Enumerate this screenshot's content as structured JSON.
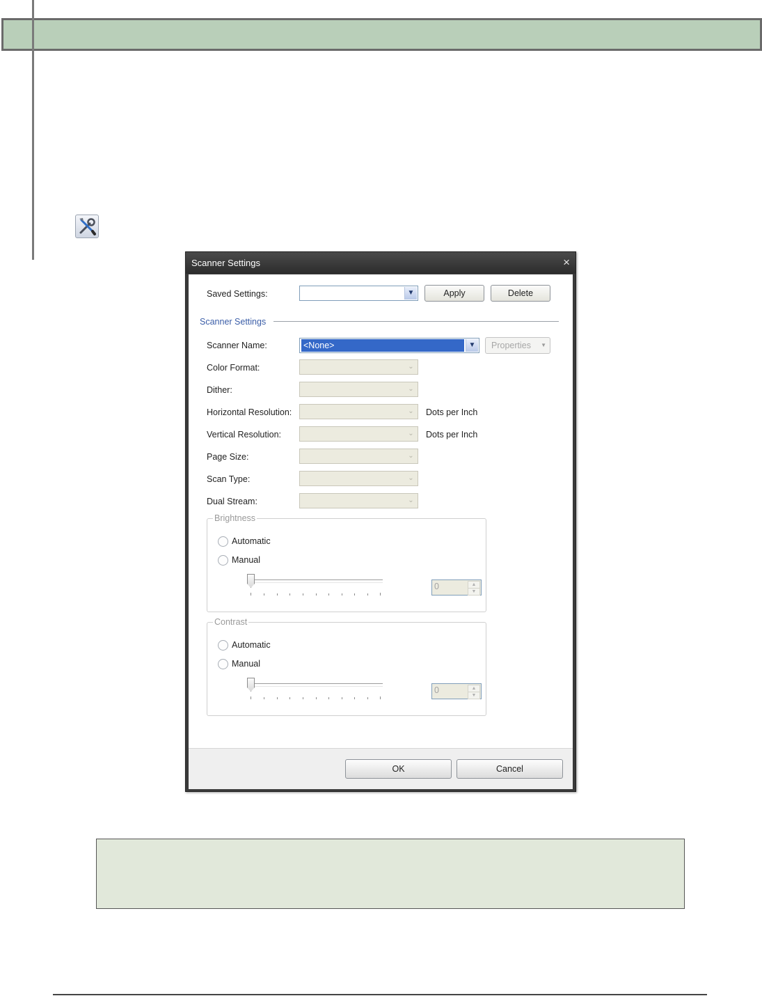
{
  "dialog": {
    "title": "Scanner Settings",
    "close_glyph": "×",
    "saved_settings": {
      "label": "Saved Settings:",
      "value": "",
      "apply_label": "Apply",
      "delete_label": "Delete"
    },
    "group_label": "Scanner Settings",
    "scanner_name": {
      "label": "Scanner Name:",
      "value": "<None>",
      "properties_label": "Properties"
    },
    "fields": [
      {
        "label": "Color Format:",
        "value": "",
        "unit": ""
      },
      {
        "label": "Dither:",
        "value": "",
        "unit": ""
      },
      {
        "label": "Horizontal Resolution:",
        "value": "",
        "unit": "Dots per Inch"
      },
      {
        "label": "Vertical Resolution:",
        "value": "",
        "unit": "Dots per Inch"
      },
      {
        "label": "Page Size:",
        "value": "",
        "unit": ""
      },
      {
        "label": "Scan Type:",
        "value": "",
        "unit": ""
      },
      {
        "label": "Dual Stream:",
        "value": "",
        "unit": ""
      }
    ],
    "brightness": {
      "title": "Brightness",
      "automatic_label": "Automatic",
      "manual_label": "Manual",
      "value": "0"
    },
    "contrast": {
      "title": "Contrast",
      "automatic_label": "Automatic",
      "manual_label": "Manual",
      "value": "0"
    },
    "ok_label": "OK",
    "cancel_label": "Cancel"
  },
  "colors": {
    "header_band": "#b9cfb9",
    "note_box": "#e1e8da",
    "selection": "#3468c8",
    "group_label": "#3b5ea8"
  },
  "icons": {
    "tool": "tools-icon",
    "dropdown": "chevron-down-icon"
  }
}
